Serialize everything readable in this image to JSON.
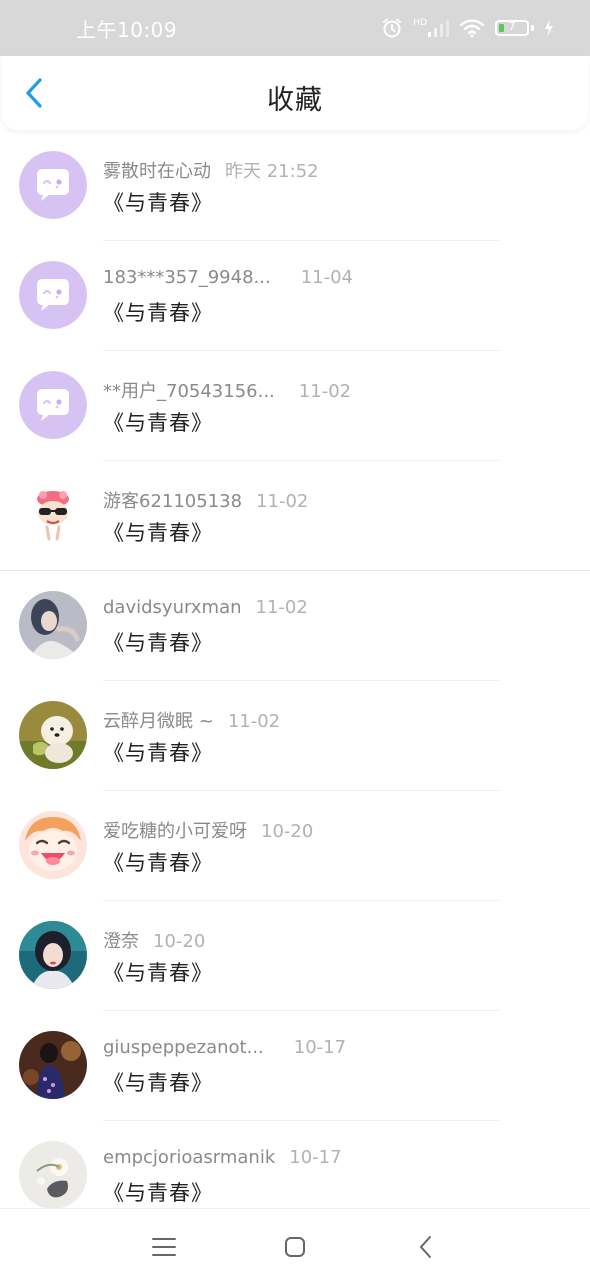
{
  "status_bar": {
    "time": "上午10:09",
    "network_label": "HD",
    "battery_level": "7",
    "icons": [
      "alarm-icon",
      "signal-icon",
      "wifi-icon",
      "battery-icon",
      "charging-icon"
    ]
  },
  "header": {
    "title": "收藏",
    "back_icon": "chevron-left-icon",
    "accent_color": "#1e9bf0"
  },
  "favorites": [
    {
      "name": "雾散时在心动",
      "time": "昨天 21:52",
      "title": "《与青春》",
      "avatar": "default-chat-avatar"
    },
    {
      "name": "183***357_9948...",
      "time": "11-04",
      "title": "《与青春》",
      "avatar": "default-chat-avatar"
    },
    {
      "name": "**用户_70543156...",
      "time": "11-02",
      "title": "《与青春》",
      "avatar": "default-chat-avatar"
    },
    {
      "name": "游客621105138",
      "time": "11-02",
      "title": "《与青春》",
      "avatar": "cartoon-sunglasses-avatar"
    },
    {
      "name": "davidsyurxman",
      "time": "11-02",
      "title": "《与青春》",
      "avatar": "photo-avatar"
    },
    {
      "name": "云醉月微眠 ~",
      "time": "11-02",
      "title": "《与青春》",
      "avatar": "puppy-photo-avatar"
    },
    {
      "name": "爱吃糖的小可爱呀",
      "time": "10-20",
      "title": "《与青春》",
      "avatar": "anime-laughing-avatar"
    },
    {
      "name": "澄奈",
      "time": "10-20",
      "title": "《与青春》",
      "avatar": "portrait-photo-avatar"
    },
    {
      "name": "giuspeppezanot...",
      "time": "10-17",
      "title": "《与青春》",
      "avatar": "night-photo-avatar"
    },
    {
      "name": "empcjorioasrmanik",
      "time": "10-17",
      "title": "《与青春》",
      "avatar": "flower-photo-avatar"
    }
  ],
  "navbar": {
    "icons": [
      "menu-icon",
      "home-square-icon",
      "back-triangle-icon"
    ]
  }
}
